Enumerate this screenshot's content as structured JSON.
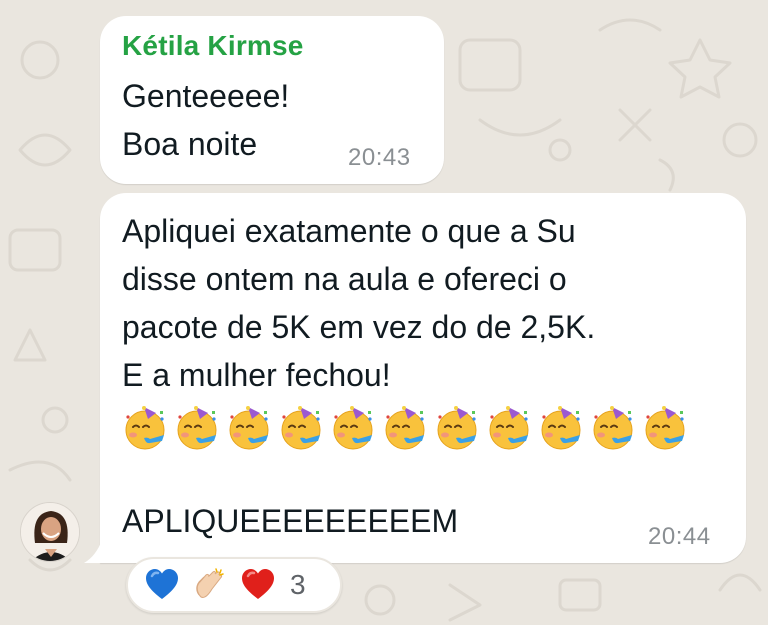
{
  "chat": {
    "messages": [
      {
        "sender": "Kétila Kirmse",
        "lines": [
          "Genteeeee!",
          "Boa noite"
        ],
        "time": "20:43"
      },
      {
        "lines": [
          "Apliquei exatamente o que a Su",
          "disse ontem na aula e ofereci o",
          "pacote de 5K em vez do de 2,5K.",
          "E a mulher fechou!"
        ],
        "emoji": "partying-face",
        "emoji_count": 11,
        "shout": "APLIQUEEEEEEEEEM",
        "time": "20:44"
      }
    ],
    "reactions": {
      "icons": [
        "blue-heart-icon",
        "clapping-hands-icon",
        "red-heart-icon"
      ],
      "count": "3"
    },
    "colors": {
      "sender_name": "#25a244",
      "bubble": "#ffffff",
      "wallpaper": "#eae6df",
      "timestamp": "#8a8f93"
    }
  }
}
